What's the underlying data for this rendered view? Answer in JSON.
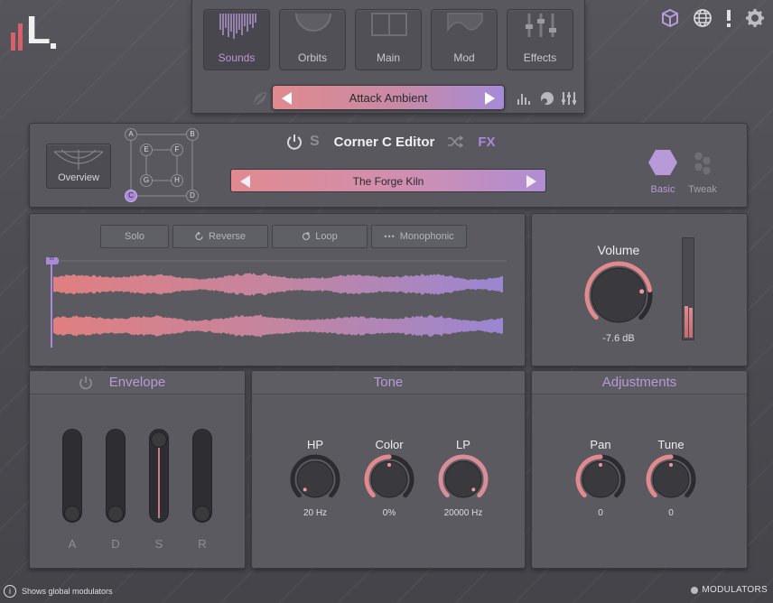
{
  "app": {
    "logo_text": "L."
  },
  "top_icons": [
    "cube-icon",
    "globe-icon",
    "alert-icon",
    "gear-icon"
  ],
  "nav": {
    "tabs": [
      {
        "label": "Sounds",
        "icon": "sounds-icon",
        "active": true
      },
      {
        "label": "Orbits",
        "icon": "orbits-icon",
        "active": false
      },
      {
        "label": "Main",
        "icon": "main-icon",
        "active": false
      },
      {
        "label": "Mod",
        "icon": "mod-icon",
        "active": false
      },
      {
        "label": "Effects",
        "icon": "effects-icon",
        "active": false
      }
    ],
    "preset": "Attack Ambient"
  },
  "editor": {
    "overview_label": "Overview",
    "grid_nodes": [
      "A",
      "B",
      "C",
      "D",
      "E",
      "F",
      "G",
      "H"
    ],
    "active_node": "C",
    "solo_letter": "S",
    "title": "Corner C Editor",
    "fx_label": "FX",
    "sound_name": "The Forge Kiln",
    "modes": [
      {
        "label": "Basic",
        "active": true
      },
      {
        "label": "Tweak",
        "active": false
      }
    ]
  },
  "sample": {
    "toggles": [
      "Solo",
      "Reverse",
      "Loop",
      "Monophonic"
    ],
    "start_marker": "I I I"
  },
  "volume": {
    "title": "Volume",
    "value_text": "-7.6 dB",
    "level": 0.8,
    "meter": [
      0.32,
      0.3
    ]
  },
  "envelope": {
    "title": "Envelope",
    "sliders": [
      {
        "label": "A",
        "value": 0.0
      },
      {
        "label": "D",
        "value": 0.0
      },
      {
        "label": "S",
        "value": 1.0
      },
      {
        "label": "R",
        "value": 0.0
      }
    ]
  },
  "tone": {
    "title": "Tone",
    "knobs": [
      {
        "label": "HP",
        "value_text": "20 Hz",
        "value": 0.0
      },
      {
        "label": "Color",
        "value_text": "0%",
        "value": 0.5
      },
      {
        "label": "LP",
        "value_text": "20000 Hz",
        "value": 1.0
      }
    ]
  },
  "adjustments": {
    "title": "Adjustments",
    "knobs": [
      {
        "label": "Pan",
        "value_text": "0",
        "value": 0.5
      },
      {
        "label": "Tune",
        "value_text": "0",
        "value": 0.5
      }
    ]
  },
  "status": {
    "hint": "Shows global modulators",
    "modulators_label": "MODULATORS"
  },
  "colors": {
    "accent_purple": "#a98ad8",
    "accent_pink": "#e08a8f",
    "panel": "#5a5a60"
  }
}
